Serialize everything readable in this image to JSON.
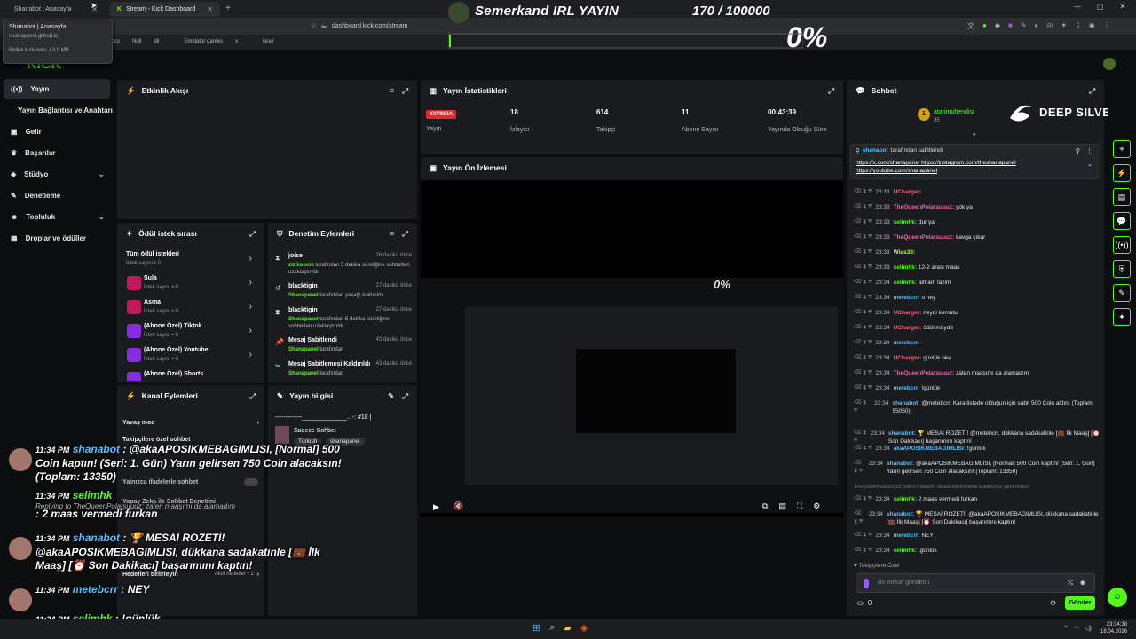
{
  "browser": {
    "tabs": [
      "Shanabot | Anasayfa",
      "Stream - Kick Dashboard"
    ],
    "url": "dashboard.kick.com/stream",
    "bookmarks": [
      "Job Docs",
      "Null",
      "dil",
      "",
      "Emulator games",
      "x",
      "",
      "israil"
    ],
    "tooltip": {
      "title": "Shanabot | Anasayfa",
      "domain": "shanapanel.github.io",
      "memory": "Bellek kullanımı: 43,9 MB"
    }
  },
  "overlay": {
    "title": "Semerkand IRL YAYIN",
    "count": "170 / 100000",
    "percent": "0%",
    "brand": "DEEP SILVER"
  },
  "sidebar": {
    "logo": "KICK",
    "items": [
      {
        "label": "Yayın",
        "icon": "broadcast-icon"
      },
      {
        "label": "Yayın Bağlantısı ve Anahtarı",
        "icon": ""
      },
      {
        "label": "Gelir",
        "icon": "money-icon"
      },
      {
        "label": "Başarılar",
        "icon": "trophy-icon"
      },
      {
        "label": "Stüdyo",
        "icon": "studio-icon"
      },
      {
        "label": "Denetleme",
        "icon": "wrench-icon"
      },
      {
        "label": "Topluluk",
        "icon": "people-icon"
      },
      {
        "label": "Droplar ve ödüller",
        "icon": "gift-icon"
      }
    ]
  },
  "activity": {
    "title": "Etkinlik Akışı"
  },
  "stats": {
    "title": "Yayın İstatistikleri",
    "live_badge": "YAYINDA",
    "items": [
      {
        "value": "",
        "label": "Yayın"
      },
      {
        "value": "18",
        "label": "İzleyici"
      },
      {
        "value": "614",
        "label": "Takipçi"
      },
      {
        "value": "11",
        "label": "Abone Sayısı"
      },
      {
        "value": "00:43:39",
        "label": "Yayında Olduğu Süre"
      }
    ]
  },
  "preview": {
    "title": "Yayın Ön İzlemesi"
  },
  "rewards": {
    "title": "Ödül istek sırası",
    "all": {
      "name": "Tüm ödül istekleri",
      "sub": "İstek sayısı • 0"
    },
    "items": [
      {
        "name": "Sula",
        "sub": "İstek sayısı • 0"
      },
      {
        "name": "Asma",
        "sub": "İstek sayısı • 0"
      },
      {
        "name": "(Abone Özel) Tiktok",
        "sub": "İstek sayısı • 0"
      },
      {
        "name": "(Abone Özel) Youtube",
        "sub": "İstek sayısı • 0"
      },
      {
        "name": "(Abone Özel) Shorts",
        "sub": ""
      }
    ]
  },
  "moderation": {
    "title": "Denetim Eylemleri",
    "items": [
      {
        "name": "joise",
        "time": "26 dakika önce",
        "by": "zizikoocm",
        "desc": "tarafından 5 dakika süreliğine sohbetten uzaklaştırıldı"
      },
      {
        "name": "blacktigin",
        "time": "27 dakika önce",
        "by": "Shanapanel",
        "desc": "tarafından yasağı kaldırıldı"
      },
      {
        "name": "blacktigin",
        "time": "27 dakika önce",
        "by": "Shanapanel",
        "desc": "tarafından 5 dakika süreliğine sohbetten uzaklaştırıldı"
      },
      {
        "name": "Mesaj Sabitlendi",
        "time": "43 dakika önce",
        "by": "Shanapanel",
        "desc": "tarafından"
      },
      {
        "name": "Mesaj Sabitlemesi Kaldırıldı",
        "time": "43 dakika önce",
        "by": "Shanapanel",
        "desc": "tarafından"
      }
    ]
  },
  "channel": {
    "title": "Kanal Eylemleri",
    "items": [
      "Yavaş mod",
      "Takipçilere özel sohbet",
      "Yalnızca ifadelerle sohbet",
      "Yapay Zeka ile Sohbet Denetimi",
      "",
      "Hedefleri belirleyin"
    ],
    "goal_status": "Aktif hedefler • 1"
  },
  "info": {
    "title": "Yayın bilgisi",
    "stream_title": "-------------_____________...-: #18 |",
    "category": "Sadece Sohbet",
    "tags": [
      "Türkish",
      "shanapanel"
    ]
  },
  "chat": {
    "title": "Sohbet",
    "top_user": "atarimuhendisi",
    "top_count": "35",
    "pinned_by": "shanabot",
    "pinned_label": "tarafından sabitlendi",
    "pinned_links": [
      "https://x.com/shanapanel",
      "https://instagram.com/theshanapanel",
      "https://youtube.com/shanapanel"
    ],
    "messages": [
      {
        "time": "23:33",
        "user": "UCharger:",
        "color": "#ff5e7a",
        "text": ""
      },
      {
        "time": "23:33",
        "user": "TheQueenPolatsuuuz:",
        "color": "#ff5ea8",
        "text": "yok ya"
      },
      {
        "time": "23:33",
        "user": "selimhk:",
        "color": "#53fc18",
        "text": "dur ya"
      },
      {
        "time": "23:33",
        "user": "TheQueenPolatsuuuz:",
        "color": "#ff5ea8",
        "text": "kavga çıkar"
      },
      {
        "time": "23:33",
        "user": "Wias33:",
        "color": "#b9f542",
        "text": ""
      },
      {
        "time": "23:33",
        "user": "selimhk:",
        "color": "#53fc18",
        "text": "12-2 arasi maas"
      },
      {
        "time": "23:34",
        "user": "selimhk:",
        "color": "#53fc18",
        "text": "almam lazim"
      },
      {
        "time": "23:34",
        "user": "metebcrr:",
        "color": "#53c1ff",
        "text": "o ney"
      },
      {
        "time": "23:34",
        "user": "UCharger:",
        "color": "#ff5e7a",
        "text": "neydi komutu"
      },
      {
        "time": "23:34",
        "user": "UCharger:",
        "color": "#ff5e7a",
        "text": "ödül müydü"
      },
      {
        "time": "23:34",
        "user": "metebcrr:",
        "color": "#53c1ff",
        "text": ""
      },
      {
        "time": "23:34",
        "user": "UCharger:",
        "color": "#ff5e7a",
        "text": "günlük oke"
      },
      {
        "time": "23:34",
        "user": "TheQueenPolatsuuuz:",
        "color": "#ff5ea8",
        "text": "zaten maaşımı da alamadım"
      },
      {
        "time": "23:34",
        "user": "metebcrr:",
        "color": "#53c1ff",
        "text": "!günlük"
      },
      {
        "time": "23:34",
        "user": "shanabot:",
        "color": "#53c1ff",
        "text": "@metebcrr, Kara listede olduğun için sabit 500 Coin aldın. (Toplam: 55050)"
      },
      {
        "time": "23:34",
        "user": "shanabot:",
        "color": "#53c1ff",
        "text": "🏆 MESAİ ROZETİ! @metebcrr, dükkana sadakatinle [💼 İlk Maaş] [⏰ Son Dakikacı] başarımını kaptın!"
      },
      {
        "time": "23:34",
        "user": "akaAPOSIKMEBAGIMLISI:",
        "color": "#53c1ff",
        "text": "!günlük"
      },
      {
        "time": "23:34",
        "user": "shanabot:",
        "color": "#53c1ff",
        "text": "@akaAPOSIKMEBAGIMLISI, [Normal] 500 Coin kaptın! (Seri: 1. Gün) Yarın gelirsen 750 Coin alacaksın! (Toplam: 13350)"
      },
      {
        "time": "23:34",
        "user": "selimhk:",
        "color": "#53fc18",
        "text": "2 maas vermedi furkan"
      },
      {
        "time": "23:34",
        "user": "shanabot:",
        "color": "#53c1ff",
        "text": "🏆 MESAİ ROZETİ! @akaAPOSIKMEBAGIMLISI, dükkana sadakatinle [💼 İlk Maaş] [⏰ Son Dakikacı] başarımını kaptın!"
      },
      {
        "time": "23:34",
        "user": "metebcrr:",
        "color": "#53c1ff",
        "text": "NEY"
      },
      {
        "time": "23:34",
        "user": "selimhk:",
        "color": "#53fc18",
        "text": "!günlük"
      }
    ],
    "reply_hint": "TheQueenPolatsuuuz: zaten maaşımı da alamadım isimli kullanıcıya yanıt veriyor",
    "followers_only": "Takipçilere Özel",
    "input_placeholder": "Bir mesaj gönderin",
    "points": "0",
    "send": "Gönder"
  },
  "overlay_chat": [
    {
      "time": "11:34 PM",
      "user": "shanabot",
      "text": ": @akaAPOSIKMEBAGIMLISI, [Normal] 500 Coin kaptın! (Seri: 1. Gün) Yarın gelirsen 750 Coin alacaksın! (Toplam: 13350)"
    },
    {
      "time": "11:34 PM",
      "user": "selimhk",
      "text": ": 2 maas vermedi furkan",
      "reply": "Replying to TheQueenPolatsuuuz: zaten maaşımı da alamadım"
    },
    {
      "time": "11:34 PM",
      "user": "shanabot",
      "text": ": 🏆 MESAİ ROZETİ! @akaAPOSIKMEBAGIMLISI, dükkana sadakatinle [💼 İlk Maaş] [⏰ Son Dakikacı] başarımını kaptın!"
    },
    {
      "time": "11:34 PM",
      "user": "metebcrr",
      "text": ": NEY"
    },
    {
      "time": "11:34 PM",
      "user": "selimhk",
      "text": ": !günlük"
    }
  ],
  "taskbar": {
    "time": "23:34:38",
    "date": "18.04.2026"
  }
}
